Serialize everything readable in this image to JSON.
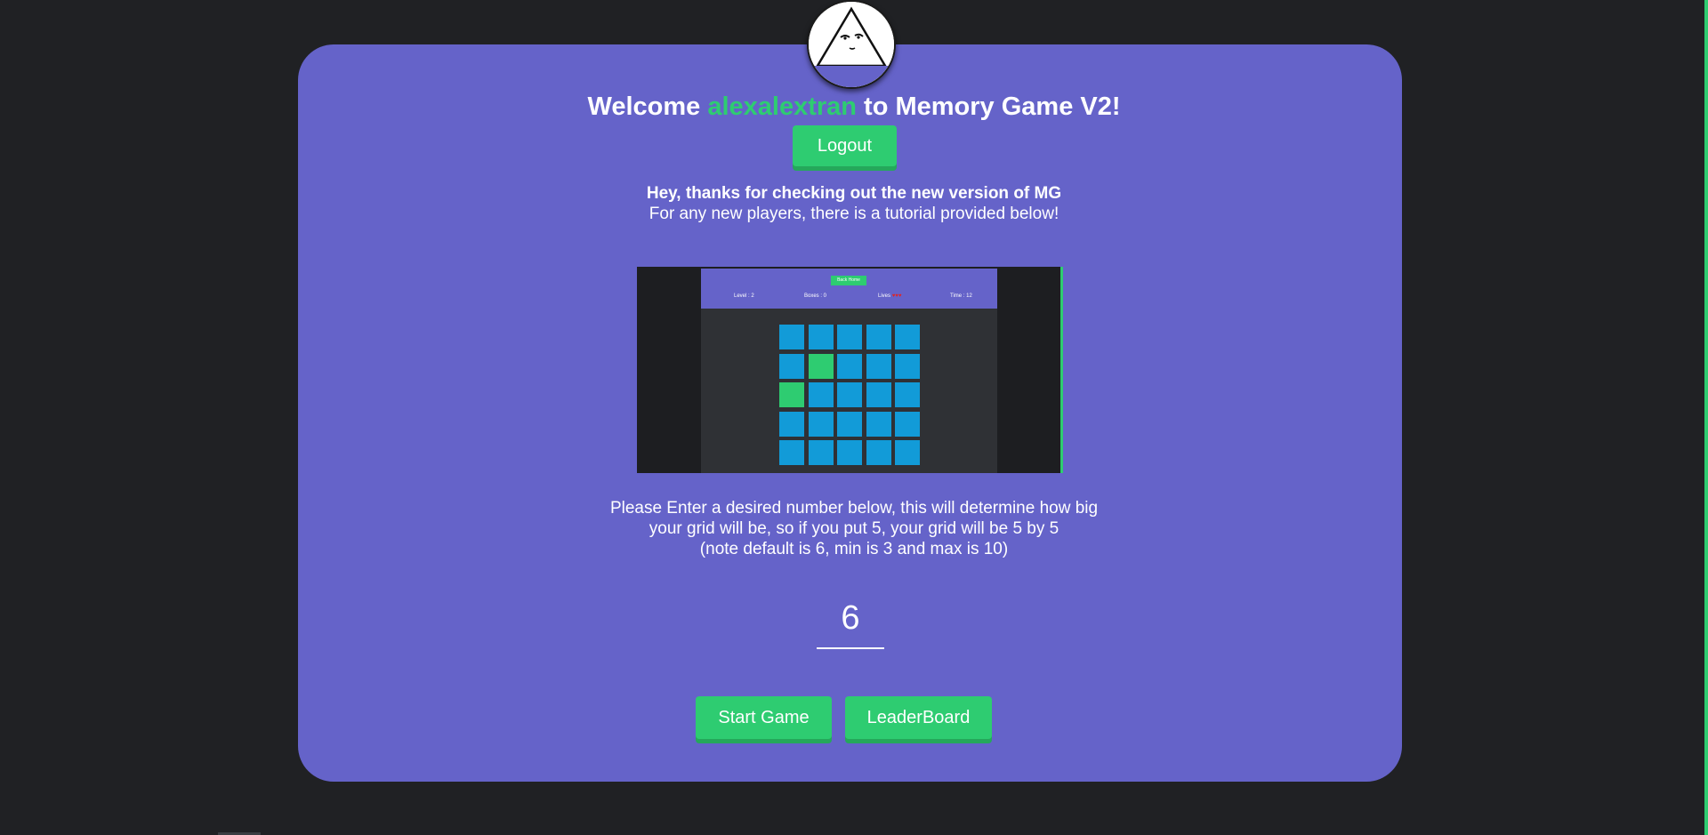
{
  "header": {
    "welcome_prefix": "Welcome ",
    "username": "alexalextran",
    "welcome_suffix": " to Memory Game V2!"
  },
  "buttons": {
    "logout": "Logout",
    "start_game": "Start Game",
    "leaderboard": "LeaderBoard"
  },
  "intro": {
    "bold_line": "Hey, thanks for checking out the new version of MG",
    "line2": "For any new players, there is a tutorial provided below!"
  },
  "tutorial": {
    "back_home": "Back Home",
    "level_label": "Level : 2",
    "boxes_label": "Boxes : 0",
    "lives_label": "Lives ",
    "hearts": "♥♥♥",
    "time_label": "Time : 12",
    "grid_size": 5,
    "green_cells": [
      [
        1,
        1
      ],
      [
        2,
        0
      ]
    ]
  },
  "instructions": {
    "line1": "Please Enter a desired number below, this will determine how big",
    "line2": "your grid will be, so if you put 5, your grid will be 5 by 5",
    "line3": "(note default is 6, min is 3 and max is 10)"
  },
  "grid_input": {
    "value": "6"
  },
  "colors": {
    "background": "#202124",
    "card": "#6563c9",
    "accent_green": "#2ecc71",
    "tile_blue": "#129bd8"
  }
}
